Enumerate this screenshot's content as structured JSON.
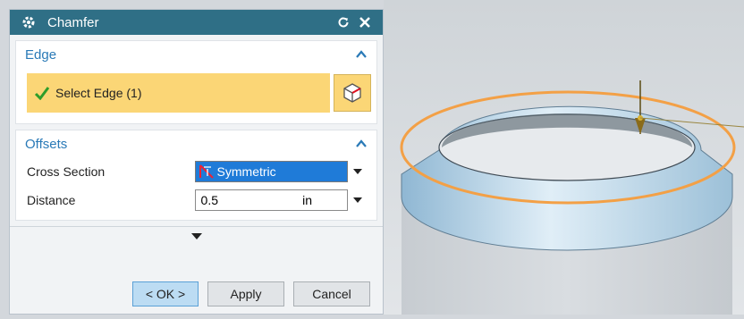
{
  "dialog": {
    "title": "Chamfer",
    "colors": {
      "titlebar": "#2f6f86",
      "accent": "#2a7ab7",
      "selection": "#fbd676"
    }
  },
  "edge_group": {
    "label": "Edge",
    "select_label": "Select Edge (1)"
  },
  "offsets_group": {
    "label": "Offsets",
    "cross_section_label": "Cross Section",
    "cross_section_value": "Symmetric",
    "distance_label": "Distance",
    "distance_value": "0.5",
    "distance_unit": "in"
  },
  "buttons": {
    "ok": "< OK >",
    "apply": "Apply",
    "cancel": "Cancel"
  }
}
